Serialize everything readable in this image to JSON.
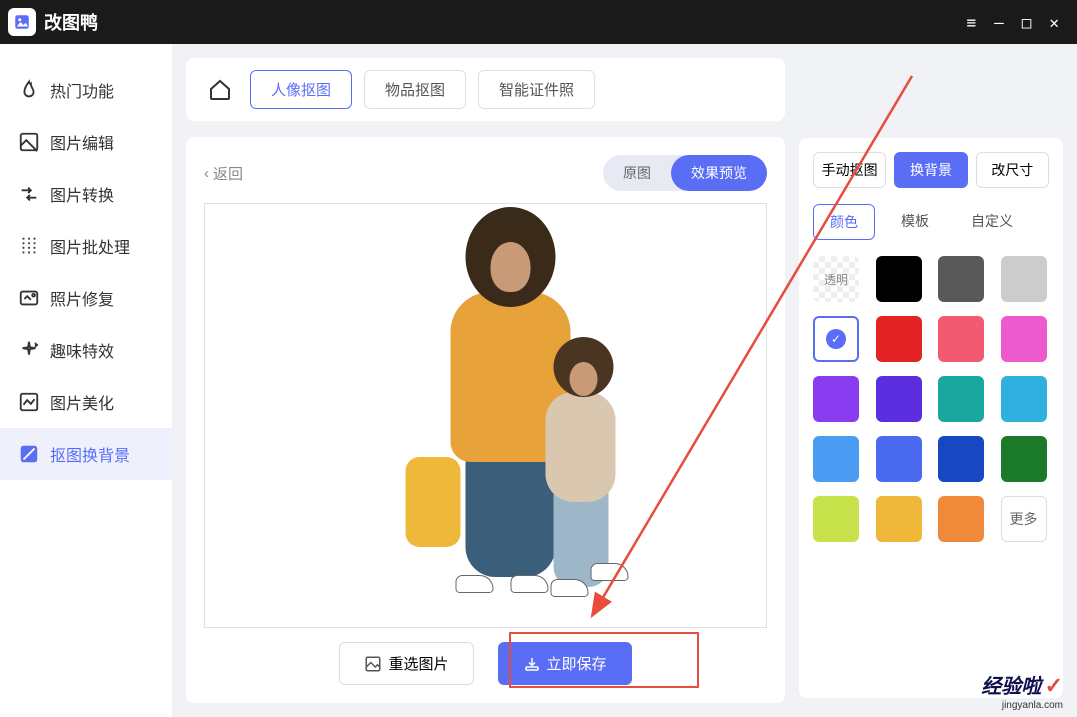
{
  "app": {
    "title": "改图鸭"
  },
  "window_controls": {
    "menu": "≡",
    "min": "—",
    "max": "□",
    "close": "✕"
  },
  "sidebar": {
    "items": [
      {
        "label": "热门功能",
        "icon": "flame-icon"
      },
      {
        "label": "图片编辑",
        "icon": "image-edit-icon"
      },
      {
        "label": "图片转换",
        "icon": "convert-icon"
      },
      {
        "label": "图片批处理",
        "icon": "batch-icon"
      },
      {
        "label": "照片修复",
        "icon": "repair-icon"
      },
      {
        "label": "趣味特效",
        "icon": "effects-icon"
      },
      {
        "label": "图片美化",
        "icon": "beautify-icon"
      },
      {
        "label": "抠图换背景",
        "icon": "cutout-icon"
      }
    ]
  },
  "top_tabs": [
    {
      "label": "人像抠图"
    },
    {
      "label": "物品抠图"
    },
    {
      "label": "智能证件照"
    }
  ],
  "preview": {
    "back": "返回",
    "original": "原图",
    "result": "效果预览"
  },
  "right_panel": {
    "modes": [
      {
        "label": "手动抠图"
      },
      {
        "label": "换背景"
      },
      {
        "label": "改尺寸"
      }
    ],
    "sub_tabs": [
      {
        "label": "颜色"
      },
      {
        "label": "模板"
      },
      {
        "label": "自定义"
      }
    ],
    "swatches": {
      "transparent_label": "透明",
      "more_label": "更多",
      "colors": [
        "transparent",
        "#000000",
        "#595959",
        "#cccccc",
        "selected-white",
        "#e32424",
        "#f25a72",
        "#ec5bcd",
        "#8a3df0",
        "#5b2fe0",
        "#1aa79e",
        "#2fb0df",
        "#4a9df2",
        "#4a6bf0",
        "#1847c2",
        "#1a7a2a",
        "#c7e24a",
        "#f0b83a",
        "#f08a3a",
        "more"
      ]
    }
  },
  "actions": {
    "reselect": "重选图片",
    "save": "立即保存"
  },
  "watermark": {
    "brand": "经验啦",
    "site": "jingyanla.com"
  }
}
